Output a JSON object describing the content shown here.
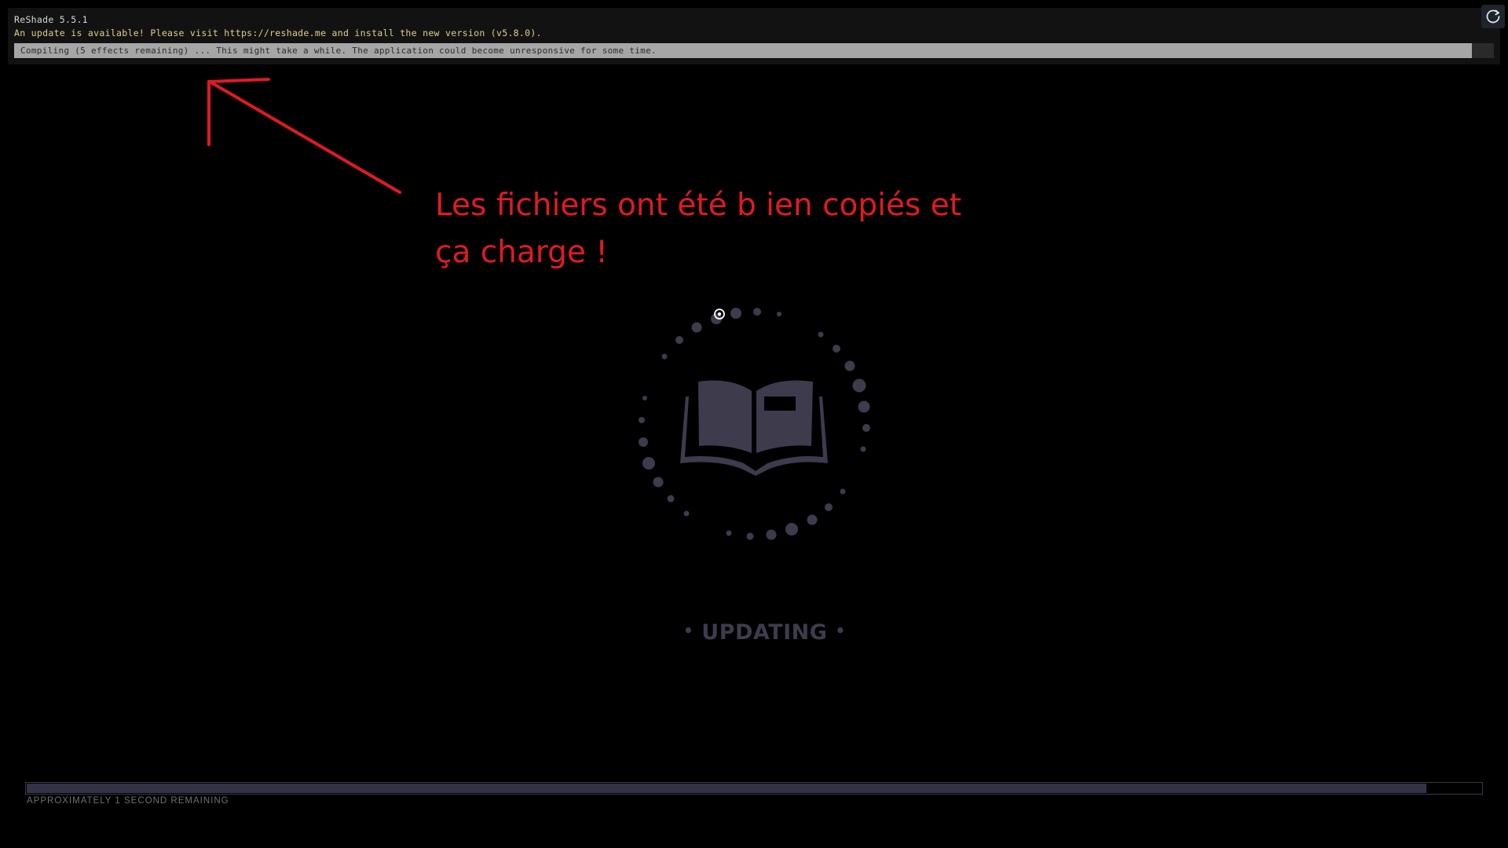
{
  "overlay": {
    "title": "ReShade 5.5.1",
    "update_notice": "An update is available! Please visit https://reshade.me and install the new version (v5.8.0).",
    "compile_status": "Compiling (5 effects remaining) ... This might take a while. The application could become unresponsive for some time.",
    "compile_progress": 0.985
  },
  "refresh_button": {
    "icon": "refresh-icon"
  },
  "annotation": {
    "line1": "Les fichiers ont été b ien copiés et",
    "line2": "ça charge !",
    "color": "#e01a22"
  },
  "loader": {
    "status": "UPDATING",
    "icon": "book-icon",
    "remaining_text": "APPROXIMATELY 1 SECOND REMAINING",
    "progress": 0.962
  },
  "colors": {
    "background": "#000000",
    "overlay_bg": "#121212",
    "update_text": "#dcd08a",
    "spinner": "#3e3b4d"
  }
}
